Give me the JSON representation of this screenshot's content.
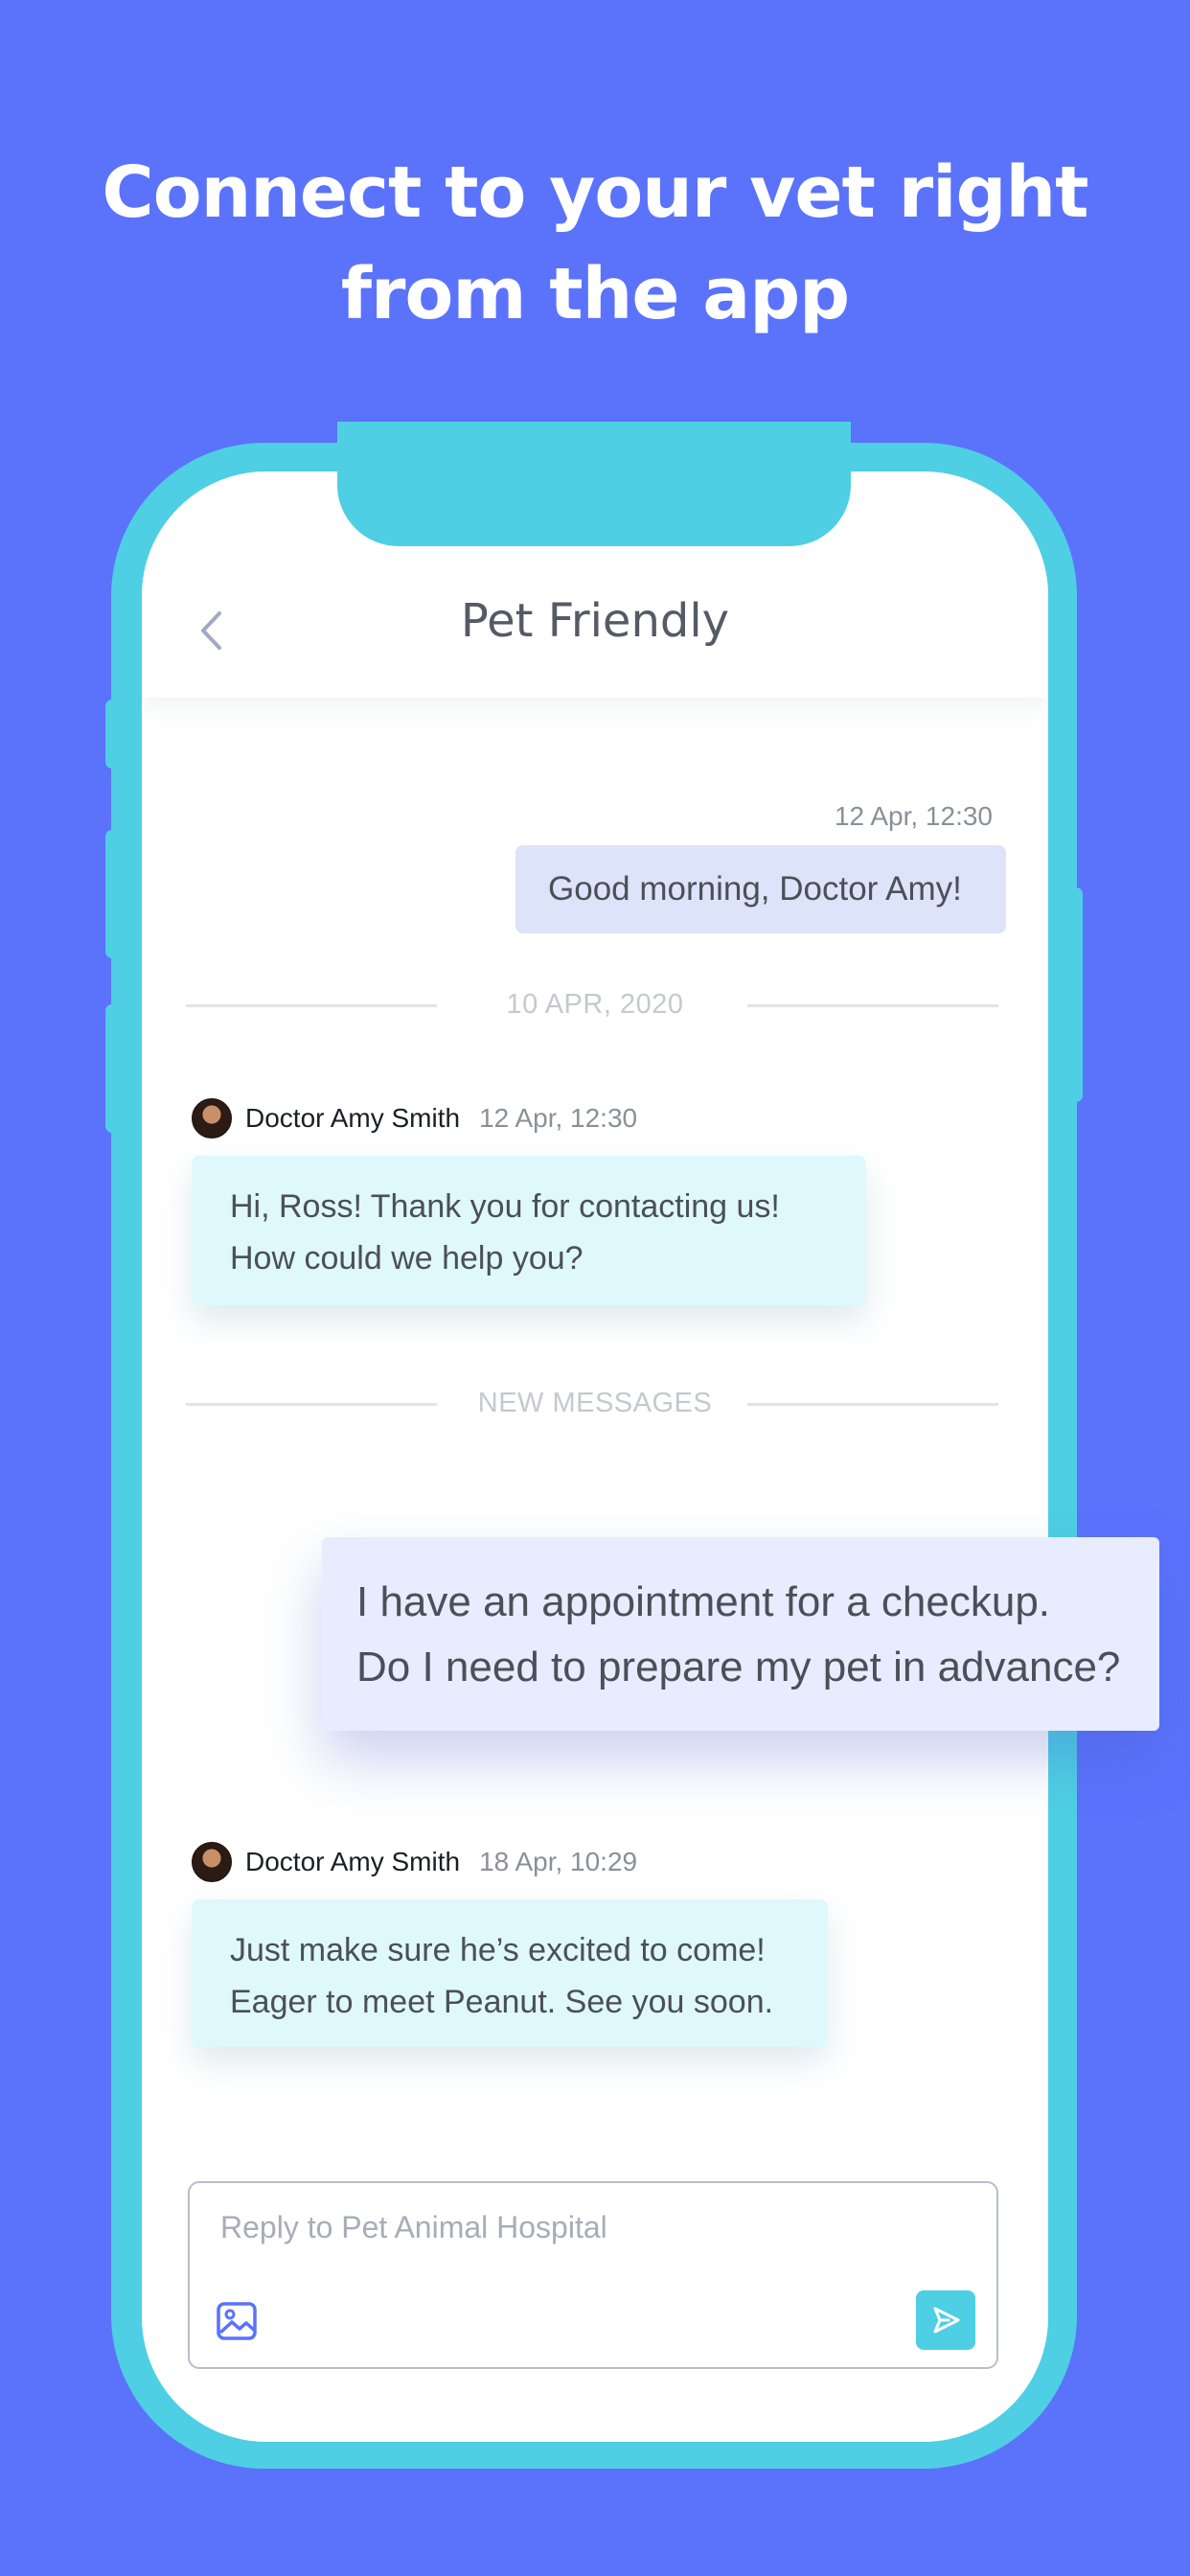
{
  "headline": {
    "line1": "Connect to your vet right",
    "line2": "from the app"
  },
  "colors": {
    "background": "#5b72fb",
    "phone_frame": "#4ecfe3",
    "outgoing_bubble": "#dde3f8",
    "incoming_bubble": "#dff8fb",
    "highlight_bubble": "#e7edff"
  },
  "header": {
    "back_icon": "chevron-left-icon",
    "title": "Pet Friendly"
  },
  "messages": {
    "outgoing1": {
      "time": "12 Apr, 12:30",
      "text": "Good morning, Doctor Amy!"
    },
    "separator1": "10 APR, 2020",
    "incoming1": {
      "sender": "Doctor Amy Smith",
      "time": "12 Apr, 12:30",
      "line1": "Hi, Ross!  Thank you for contacting us!",
      "line2": "How could we help you?"
    },
    "separator2": "NEW MESSAGES",
    "highlight": {
      "line1": "I have an appointment for a checkup.",
      "line2": "Do I need to prepare my pet in advance?"
    },
    "incoming2": {
      "sender": "Doctor Amy Smith",
      "time": "18 Apr, 10:29",
      "line1": "Just make sure he’s excited to come!",
      "line2": "Eager to meet Peanut. See you soon."
    }
  },
  "composer": {
    "placeholder": "Reply to Pet Animal Hospital",
    "value": "",
    "attach_icon": "image-icon",
    "send_icon": "send-icon"
  }
}
